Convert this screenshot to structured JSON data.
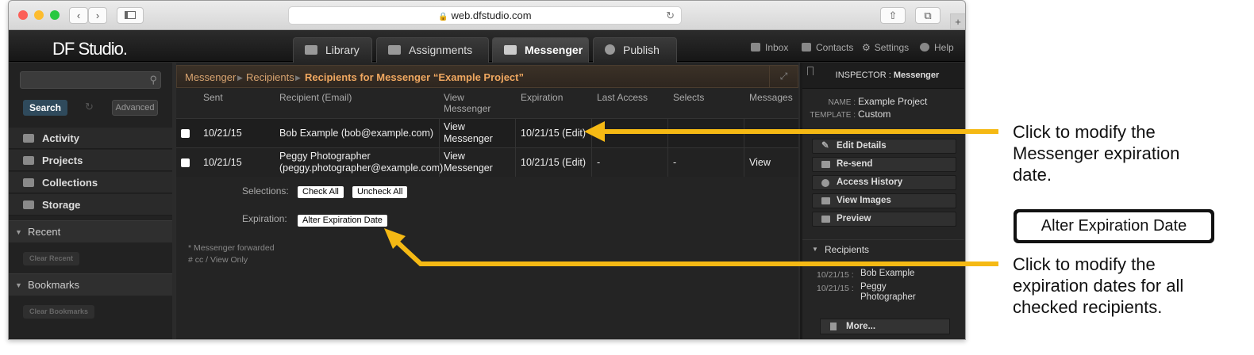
{
  "browser": {
    "url": "web.dfstudio.com",
    "lock_icon": "lock-icon",
    "back": "‹",
    "forward": "›"
  },
  "app": {
    "logo": "DF Studio.",
    "tabs": [
      {
        "label": "Library",
        "icon": "library-icon"
      },
      {
        "label": "Assignments",
        "icon": "assignments-icon"
      },
      {
        "label": "Messenger",
        "icon": "messenger-icon",
        "active": true
      },
      {
        "label": "Publish",
        "icon": "publish-icon"
      }
    ],
    "top_links": [
      {
        "label": "Inbox",
        "icon": "inbox-icon"
      },
      {
        "label": "Contacts",
        "icon": "contacts-icon"
      },
      {
        "label": "Settings",
        "icon": "settings-icon"
      },
      {
        "label": "Help",
        "icon": "help-icon"
      }
    ]
  },
  "sidebar": {
    "search_button": "Search",
    "advanced_button": "Advanced",
    "nav": [
      {
        "label": "Activity",
        "icon": "activity-icon"
      },
      {
        "label": "Projects",
        "icon": "projects-icon"
      },
      {
        "label": "Collections",
        "icon": "collections-icon"
      },
      {
        "label": "Storage",
        "icon": "storage-icon"
      }
    ],
    "recent": {
      "label": "Recent",
      "clear": "Clear Recent"
    },
    "bookmarks": {
      "label": "Bookmarks",
      "clear": "Clear Bookmarks"
    }
  },
  "main": {
    "breadcrumb": {
      "items": [
        "Messenger",
        "Recipients"
      ],
      "current": "Recipients for Messenger “Example Project”"
    },
    "columns": {
      "sent": "Sent",
      "recipient": "Recipient (Email)",
      "view": "View\nMessenger",
      "expiration": "Expiration",
      "last_access": "Last Access",
      "selects": "Selects",
      "messages": "Messages"
    },
    "rows": [
      {
        "sent": "10/21/15",
        "recipient": "Bob Example (bob@example.com)",
        "view": "View\nMessenger",
        "expiration": "10/21/15 (Edit)",
        "last_access": "",
        "selects": "",
        "messages": ""
      },
      {
        "sent": "10/21/15",
        "recipient": "Peggy Photographer\n(peggy.photographer@example.com)",
        "view": "View\nMessenger",
        "expiration": "10/21/15 (Edit)",
        "last_access": "-",
        "selects": "-",
        "messages": "View"
      }
    ],
    "selections_label": "Selections:",
    "check_all": "Check All",
    "uncheck_all": "Uncheck All",
    "expiration_label": "Expiration:",
    "alter_expiration": "Alter Expiration Date",
    "notes": [
      "* Messenger forwarded",
      "# cc / View Only"
    ]
  },
  "inspector": {
    "title_prefix": "INSPECTOR : ",
    "title": "Messenger",
    "name_label": "NAME :",
    "name_value": "Example Project",
    "template_label": "TEMPLATE :",
    "template_value": "Custom",
    "buttons": [
      "Edit Details",
      "Re-send",
      "Access History",
      "View Images",
      "Preview"
    ],
    "recipients_label": "Recipients",
    "recipients": [
      {
        "date": "10/21/15 :",
        "name": "Bob Example"
      },
      {
        "date": "10/21/15 :",
        "name": "Peggy\nPhotographer"
      }
    ],
    "more": "More..."
  },
  "annotations": {
    "top": "Click to modify the\nMessenger expiration\ndate.",
    "button": "Alter Expiration Date",
    "bottom": "Click to modify the\nexpiration dates for all\nchecked recipients.",
    "arrow_color": "#f5b914"
  }
}
